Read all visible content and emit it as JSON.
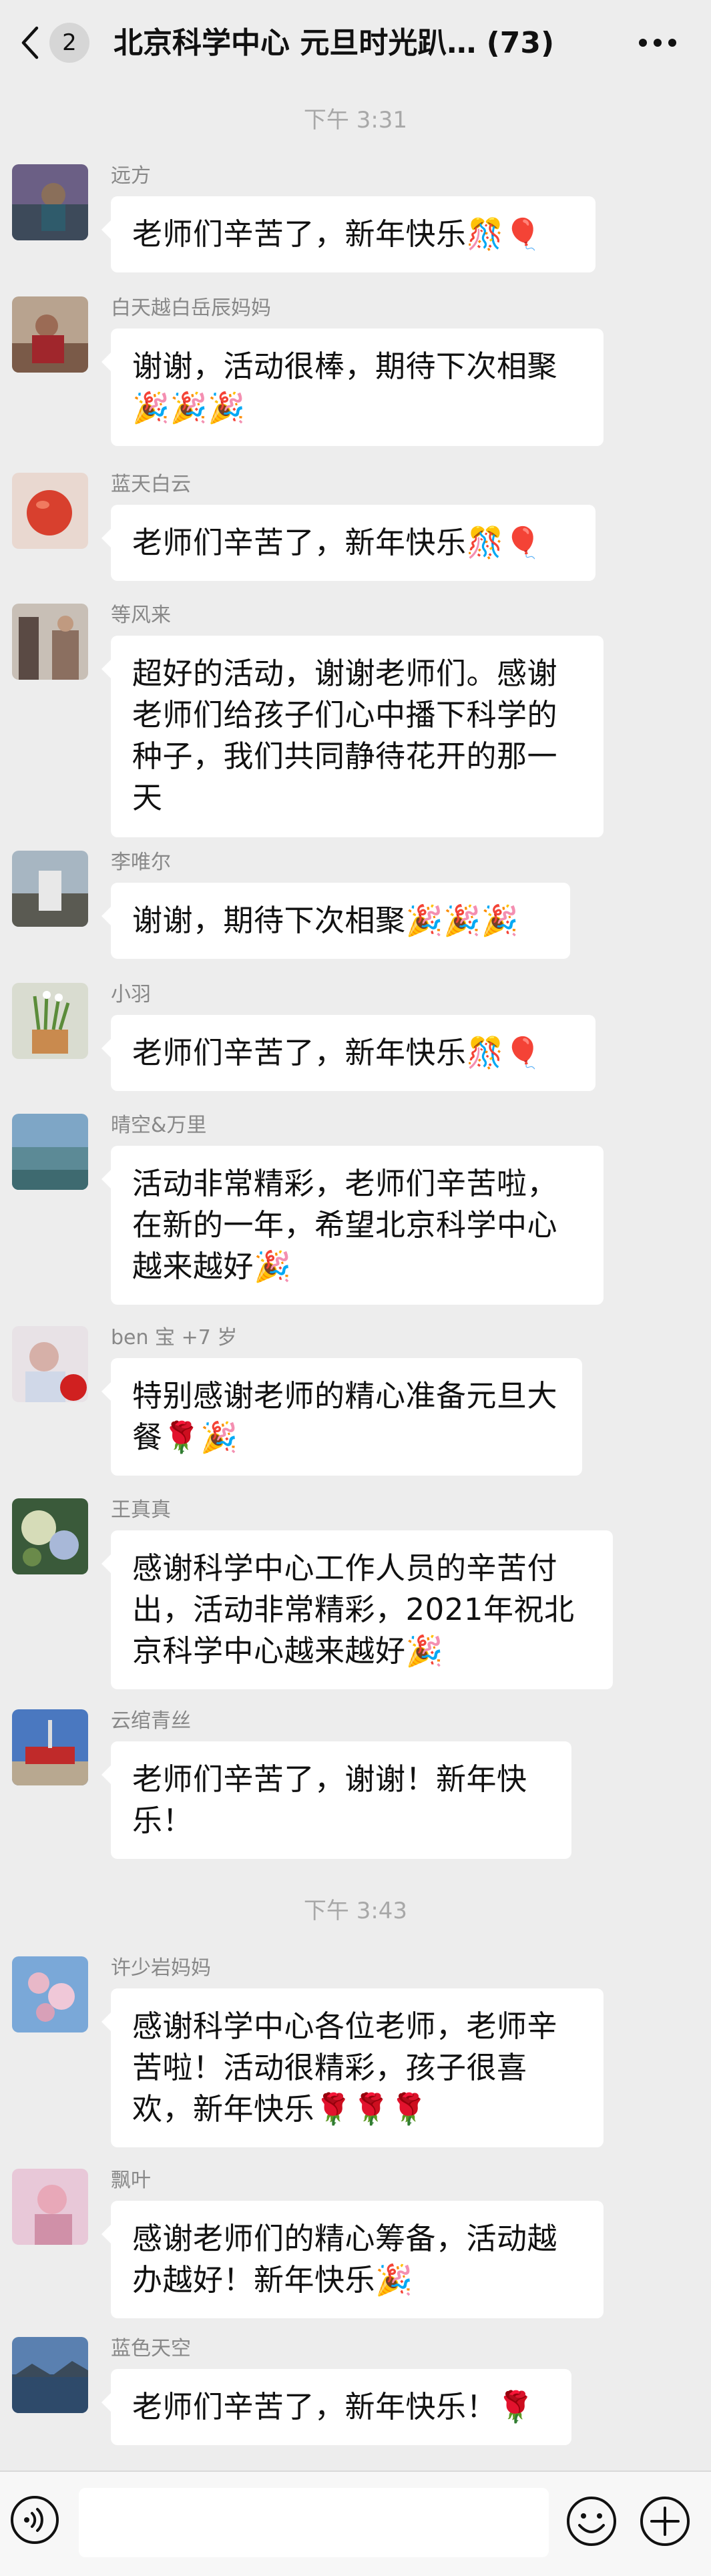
{
  "header": {
    "badge": "2",
    "title": "北京科学中心  元旦时光趴… (73)"
  },
  "time_separators": [
    "下午 3:31",
    "下午 3:43"
  ],
  "messages": [
    {
      "sender": "远方",
      "text": "老师们辛苦了，新年快乐🎊🎈"
    },
    {
      "sender": "白天越白岳辰妈妈",
      "text": "谢谢，活动很棒，期待下次相聚🎉🎉🎉"
    },
    {
      "sender": "蓝天白云",
      "text": "老师们辛苦了，新年快乐🎊🎈"
    },
    {
      "sender": "等风来",
      "text": "超好的活动，谢谢老师们。感谢老师们给孩子们心中播下科学的种子，我们共同静待花开的那一天"
    },
    {
      "sender": "李唯尔",
      "text": "谢谢，期待下次相聚🎉🎉🎉"
    },
    {
      "sender": "小羽",
      "text": "老师们辛苦了，新年快乐🎊🎈"
    },
    {
      "sender": "晴空&万里",
      "text": "活动非常精彩，老师们辛苦啦，在新的一年，希望北京科学中心越来越好🎉"
    },
    {
      "sender": "ben 宝 +7 岁",
      "text": "特别感谢老师的精心准备元旦大餐🌹🎉"
    },
    {
      "sender": "王真真",
      "text": "感谢科学中心工作人员的辛苦付出，活动非常精彩，2021年祝北京科学中心越来越好🎉"
    },
    {
      "sender": "云绾青丝",
      "text": "老师们辛苦了，谢谢！新年快乐！"
    },
    {
      "sender": "许少岩妈妈",
      "text": "感谢科学中心各位老师，老师辛苦啦！活动很精彩，孩子很喜欢，新年快乐🌹🌹🌹"
    },
    {
      "sender": "飘叶",
      "text": "感谢老师们的精心筹备，活动越办越好！新年快乐🎉"
    },
    {
      "sender": "蓝色天空",
      "text": "老师们辛苦了，新年快乐！🌹"
    }
  ],
  "input": {
    "placeholder": ""
  },
  "icons": {
    "back": "chevron-left-icon",
    "more": "more-dots-icon",
    "voice": "voice-icon",
    "emoji": "emoji-icon",
    "plus": "plus-icon"
  },
  "colors": {
    "background": "#ededed",
    "bubble": "#ffffff",
    "sender_text": "#888888",
    "time_text": "#a8a8a8"
  }
}
